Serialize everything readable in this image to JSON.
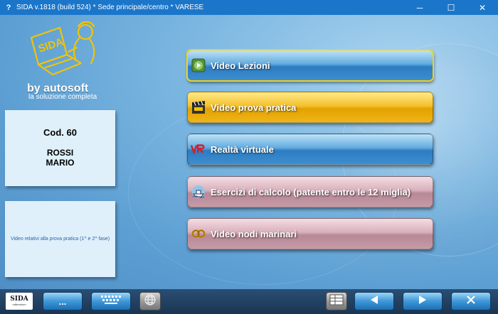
{
  "window": {
    "title": "SIDA v.1818 (build 524) * Sede principale/centro * VARESE",
    "icon": "question-icon",
    "icon_glyph": "?",
    "controls": {
      "minimize": "─",
      "maximize": "☐",
      "close": "✕"
    }
  },
  "brand": {
    "logo_text": "SIDA",
    "name": "by autosoft",
    "tagline": "la soluzione completa"
  },
  "user": {
    "code": "Cod. 60",
    "surname": "ROSSI",
    "name": "MARIO"
  },
  "info": {
    "text": "Video relativi alla prova pratica (1^ e 2^ fase)"
  },
  "menu": [
    {
      "label": "Video Lezioni",
      "icon": "play-icon",
      "style": "blue"
    },
    {
      "label": "Video prova pratica",
      "icon": "clapperboard-icon",
      "style": "gold"
    },
    {
      "label": "Realtà virtuale",
      "icon": "vr-icon",
      "style": "blue"
    },
    {
      "label": "Esercizi di calcolo (patente entro le 12 miglia)",
      "icon": "ship-icon",
      "style": "pink"
    },
    {
      "label": "Video nodi marinari",
      "icon": "knot-icon",
      "style": "pink"
    }
  ],
  "bottom": {
    "logo_text": "SIDA",
    "logo_sub": "millennium",
    "more_label": "...",
    "keyboard_icon": "keyboard-icon",
    "globe_icon": "globe-icon",
    "list_icon": "list-icon",
    "prev_icon": "arrow-left-icon",
    "next_icon": "arrow-right-icon",
    "close_icon": "close-icon"
  },
  "colors": {
    "titlebar": "#1b76c9",
    "accent_blue": "#2d7cc2",
    "accent_gold": "#e2a200",
    "accent_pink": "#b88897",
    "logo_yellow": "#f2c400"
  }
}
